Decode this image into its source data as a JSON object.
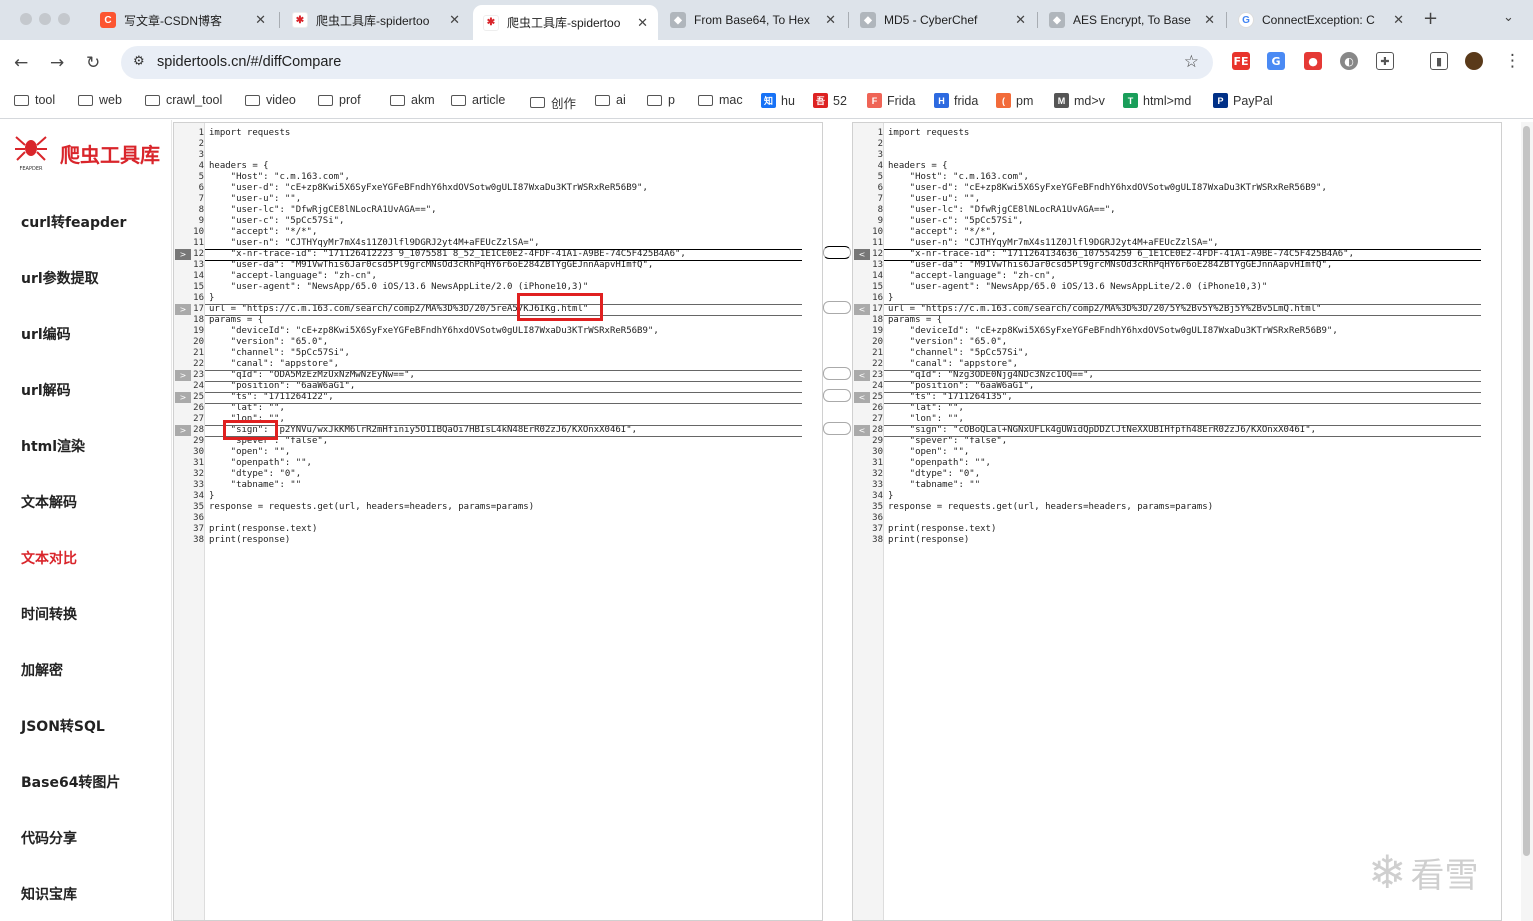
{
  "browser": {
    "tabs": [
      {
        "label": "写文章-CSDN博客",
        "icon": "csdn-icon",
        "color": "#fc5531"
      },
      {
        "label": "爬虫工具库-spidertoo",
        "icon": "spider-icon",
        "color": "#d9252b"
      },
      {
        "label": "爬虫工具库-spidertoo",
        "icon": "spider-icon",
        "color": "#d9252b"
      },
      {
        "label": "From Base64, To Hex",
        "icon": "cyberchef-icon",
        "color": "#9aa0a6"
      },
      {
        "label": "MD5 - CyberChef",
        "icon": "cyberchef-icon",
        "color": "#9aa0a6"
      },
      {
        "label": "AES Encrypt, To Base",
        "icon": "cyberchef-icon",
        "color": "#9aa0a6"
      },
      {
        "label": "ConnectException: C",
        "icon": "google-icon",
        "color": "#4285f4"
      }
    ],
    "close_glyph": "✕",
    "new_tab": "+",
    "url": "spidertools.cn/#/diffCompare",
    "bookmarks": [
      {
        "label": "tool",
        "type": "folder"
      },
      {
        "label": "web",
        "type": "folder"
      },
      {
        "label": "crawl_tool",
        "type": "folder"
      },
      {
        "label": "video",
        "type": "folder"
      },
      {
        "label": "prof",
        "type": "folder"
      },
      {
        "label": "akm",
        "type": "folder"
      },
      {
        "label": "article",
        "type": "folder"
      },
      {
        "label": "创作",
        "type": "folder"
      },
      {
        "label": "ai",
        "type": "folder"
      },
      {
        "label": "p",
        "type": "folder"
      },
      {
        "label": "mac",
        "type": "folder"
      },
      {
        "label": "hu",
        "type": "icon",
        "glyph": "知",
        "color": "#1772f6"
      },
      {
        "label": "52",
        "type": "icon",
        "glyph": "吾",
        "color": "#d22"
      },
      {
        "label": "Frida",
        "type": "icon",
        "glyph": "F",
        "color": "#ef6456"
      },
      {
        "label": "frida",
        "type": "icon",
        "glyph": "H",
        "color": "#2d6ae0"
      },
      {
        "label": "pm",
        "type": "icon",
        "glyph": "(",
        "color": "#f26b3a"
      },
      {
        "label": "md>v",
        "type": "icon",
        "glyph": "M",
        "color": "#555"
      },
      {
        "label": "html>md",
        "type": "icon",
        "glyph": "T",
        "color": "#1a9e5a"
      },
      {
        "label": "PayPal",
        "type": "icon",
        "glyph": "P",
        "color": "#003087"
      }
    ]
  },
  "sidebar": {
    "brand": "爬虫工具库",
    "logo_text": "FEAPDER",
    "items": [
      {
        "label": "curl转feapder",
        "active": false
      },
      {
        "label": "url参数提取",
        "active": false
      },
      {
        "label": "url编码",
        "active": false
      },
      {
        "label": "url解码",
        "active": false
      },
      {
        "label": "html渲染",
        "active": false
      },
      {
        "label": "文本解码",
        "active": false
      },
      {
        "label": "文本对比",
        "active": true
      },
      {
        "label": "时间转换",
        "active": false
      },
      {
        "label": "加解密",
        "active": false
      },
      {
        "label": "JSON转SQL",
        "active": false
      },
      {
        "label": "Base64转图片",
        "active": false
      },
      {
        "label": "代码分享",
        "active": false
      },
      {
        "label": "知识宝库",
        "active": false
      }
    ]
  },
  "diff": {
    "left": [
      "import requests",
      "",
      "",
      "headers = {",
      "    \"Host\": \"c.m.163.com\",",
      "    \"user-d\": \"cE+zp8Kwi5X6SyFxeYGFeBFndhY6hxdOVSotw0gULI87WxaDu3KTrWSRxReR56B9\",",
      "    \"user-u\": \"\",",
      "    \"user-lc\": \"DfwRjgCE8lNLocRA1UvAGA==\",",
      "    \"user-c\": \"5pCc57Si\",",
      "    \"accept\": \"*/*\",",
      "    \"user-n\": \"CJTHYqyMr7mX4s11Z0Jlfl9DGRJ2yt4M+aFEUcZzlSA=\",",
      "    \"x-nr-trace-id\": \"171126412223 9_1075581 8_52_1E1CE0E2-4FDF-41A1-A9BE-74C5F425B4A6\",",
      "    \"user-da\": \"M91VwThis6Jar0csd5Pl9grcMNsOd3cRhPqHY6r6oE284ZBTYgGEJnnAapvHImfQ\",",
      "    \"accept-language\": \"zh-cn\",",
      "    \"user-agent\": \"NewsApp/65.0 iOS/13.6 NewsAppLite/2.0 (iPhone10,3)\"",
      "}",
      "url = \"https://c.m.163.com/search/comp2/MA%3D%3D/20/5reA57KJ6IKg.html\"",
      "params = {",
      "    \"deviceId\": \"cE+zp8Kwi5X6SyFxeYGFeBFndhY6hxdOVSotw0gULI87WxaDu3KTrWSRxReR56B9\",",
      "    \"version\": \"65.0\",",
      "    \"channel\": \"5pCc57Si\",",
      "    \"canal\": \"appstore\",",
      "    \"qId\": \"ODA5MzEzMzUxNzMwNzEyNw==\",",
      "    \"position\": \"6aaW6aG1\",",
      "    \"ts\": \"1711264122\",",
      "    \"lat\": \"\",",
      "    \"lon\": \"\",",
      "    \"sign\": \"p2YNVu/wxJkKM6lrR2mHfiniy5O1IBQaOi7HBIsL4kN48ErR02zJ6/KXOnxX046I\",",
      "    \"spever\": \"false\",",
      "    \"open\": \"\",",
      "    \"openpath\": \"\",",
      "    \"dtype\": \"0\",",
      "    \"tabname\": \"\"",
      "}",
      "response = requests.get(url, headers=headers, params=params)",
      "",
      "print(response.text)",
      "print(response)"
    ],
    "right": [
      "import requests",
      "",
      "",
      "headers = {",
      "    \"Host\": \"c.m.163.com\",",
      "    \"user-d\": \"cE+zp8Kwi5X6SyFxeYGFeBFndhY6hxdOVSotw0gULI87WxaDu3KTrWSRxReR56B9\",",
      "    \"user-u\": \"\",",
      "    \"user-lc\": \"DfwRjgCE8lNLocRA1UvAGA==\",",
      "    \"user-c\": \"5pCc57Si\",",
      "    \"accept\": \"*/*\",",
      "    \"user-n\": \"CJTHYqyMr7mX4s11Z0Jlfl9DGRJ2yt4M+aFEUcZzlSA=\",",
      "    \"x-nr-trace-id\": \"1711264134636_107554259 6_1E1CE0E2-4FDF-41A1-A9BE-74C5F425B4A6\",",
      "    \"user-da\": \"M91VwThis6Jar0csd5Pl9grcMNsOd3cRhPqHY6r6oE284ZBTYgGEJnnAapvHImfQ\",",
      "    \"accept-language\": \"zh-cn\",",
      "    \"user-agent\": \"NewsApp/65.0 iOS/13.6 NewsAppLite/2.0 (iPhone10,3)\"",
      "}",
      "url = \"https://c.m.163.com/search/comp2/MA%3D%3D/20/5Y%2Bv5Y%2Bj5Y%2Bv5LmQ.html\"",
      "params = {",
      "    \"deviceId\": \"cE+zp8Kwi5X6SyFxeYGFeBFndhY6hxdOVSotw0gULI87WxaDu3KTrWSRxReR56B9\",",
      "    \"version\": \"65.0\",",
      "    \"channel\": \"5pCc57Si\",",
      "    \"canal\": \"appstore\",",
      "    \"qId\": \"Nzg3ODE0Njg4NDc3Nzc1OQ==\",",
      "    \"position\": \"6aaW6aG1\",",
      "    \"ts\": \"1711264135\",",
      "    \"lat\": \"\",",
      "    \"lon\": \"\",",
      "    \"sign\": \"cOBoQLal+NGNxUFLk4gUWidQpDDZlJtNeXXUBIHfpfh48ErR02zJ6/KXOnxX046I\",",
      "    \"spever\": \"false\",",
      "    \"open\": \"\",",
      "    \"openpath\": \"\",",
      "    \"dtype\": \"0\",",
      "    \"tabname\": \"\"",
      "}",
      "response = requests.get(url, headers=headers, params=params)",
      "",
      "print(response.text)",
      "print(response)"
    ],
    "changed_lines": [
      12,
      17,
      23,
      25,
      28
    ],
    "active_line": 12,
    "marker_left": ">",
    "marker_right": "<"
  },
  "watermark": "看雪"
}
